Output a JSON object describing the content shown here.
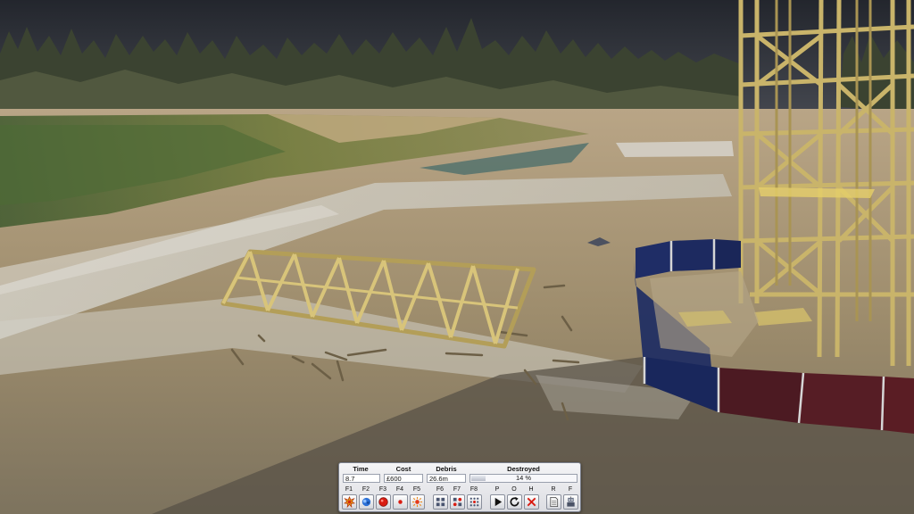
{
  "hud": {
    "time": {
      "label": "Time",
      "value": "8.7"
    },
    "cost": {
      "label": "Cost",
      "value": "£600"
    },
    "debris": {
      "label": "Debris",
      "value": "26.6m"
    },
    "destroyed": {
      "label": "Destroyed",
      "value": "14 %",
      "fraction": 0.14
    },
    "controls": [
      {
        "key": "F1",
        "icon": "explosion-icon"
      },
      {
        "key": "F2",
        "icon": "blue-blast-icon"
      },
      {
        "key": "F3",
        "icon": "red-charge-icon"
      },
      {
        "key": "F4",
        "icon": "small-charge-icon"
      },
      {
        "key": "F5",
        "icon": "burst-icon"
      },
      {
        "key": "F6",
        "icon": "grid-icon"
      },
      {
        "key": "F7",
        "icon": "red-dots-grid-icon"
      },
      {
        "key": "F8",
        "icon": "dotted-grid-icon"
      },
      {
        "key": "P",
        "icon": "play-icon"
      },
      {
        "key": "O",
        "icon": "reset-icon"
      },
      {
        "key": "H",
        "icon": "cancel-icon"
      },
      {
        "key": "R",
        "icon": "file-icon"
      },
      {
        "key": "F",
        "icon": "robot-icon"
      }
    ]
  },
  "colors": {
    "sky": "#2c3038",
    "structure": "#c9b46a",
    "fence_blue": "#1d2c63",
    "fence_red": "#5a1d24"
  }
}
